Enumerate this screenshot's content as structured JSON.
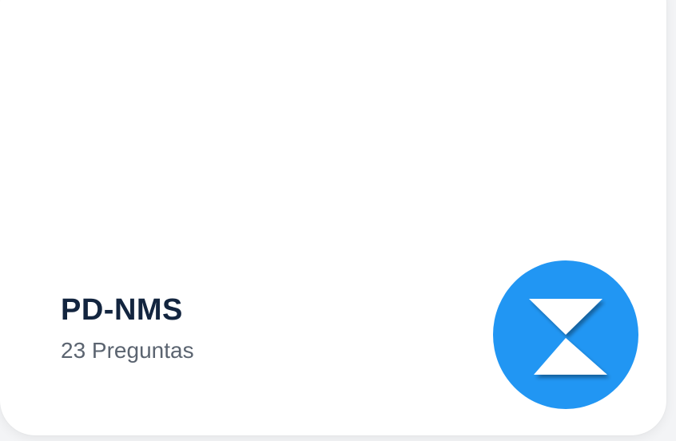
{
  "quiz": {
    "title": "PD-NMS",
    "question_count_label": "23 Preguntas"
  },
  "badge": {
    "icon": "hourglass-icon",
    "color": "#2196f3",
    "glyph_color": "#ffffff"
  }
}
